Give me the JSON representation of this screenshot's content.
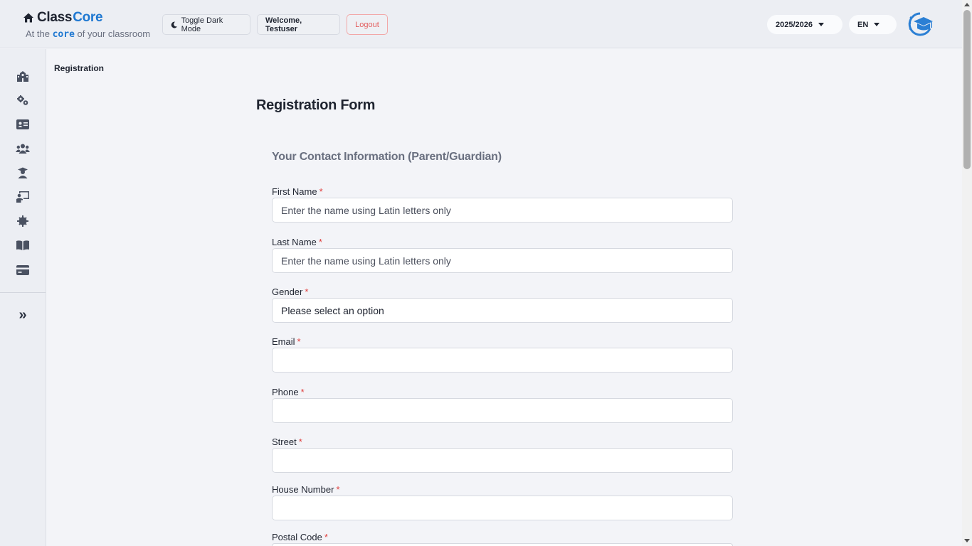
{
  "brand": {
    "name_part1": "Class",
    "name_part2": "Core",
    "tagline_before": "At the",
    "tagline_core": "core",
    "tagline_after": "of your classroom"
  },
  "header": {
    "dark_mode_label": "Toggle Dark Mode",
    "welcome_label": "Welcome, Testuser",
    "logout_label": "Logout",
    "year_selected": "2025/2026",
    "lang_selected": "EN"
  },
  "sidebar": {
    "items": [
      {
        "icon": "school-icon"
      },
      {
        "icon": "gears-icon"
      },
      {
        "icon": "id-card-icon"
      },
      {
        "icon": "users-icon"
      },
      {
        "icon": "graduate-icon"
      },
      {
        "icon": "chalkboard-teacher-icon"
      },
      {
        "icon": "cog-icon"
      },
      {
        "icon": "book-open-icon"
      },
      {
        "icon": "credit-card-icon"
      }
    ],
    "expand_glyph": "»"
  },
  "breadcrumb": "Registration",
  "form": {
    "title": "Registration Form",
    "section_title": "Your Contact Information (Parent/Guardian)",
    "required_mark": "*",
    "fields": [
      {
        "label": "First Name",
        "placeholder": "Enter the name using Latin letters only",
        "value": ""
      },
      {
        "label": "Last Name",
        "placeholder": "Enter the name using Latin letters only",
        "value": ""
      },
      {
        "label": "Gender",
        "selected": "Please select an option"
      },
      {
        "label": "Email",
        "placeholder": "",
        "value": ""
      },
      {
        "label": "Phone",
        "placeholder": "",
        "value": ""
      },
      {
        "label": "Street",
        "placeholder": "",
        "value": ""
      },
      {
        "label": "House Number",
        "placeholder": "",
        "value": ""
      },
      {
        "label": "Postal Code",
        "placeholder": "",
        "value": ""
      }
    ]
  },
  "colors": {
    "brand_blue": "#1f78d1",
    "required_red": "#e0413f",
    "logout_red": "#e35d5d"
  }
}
